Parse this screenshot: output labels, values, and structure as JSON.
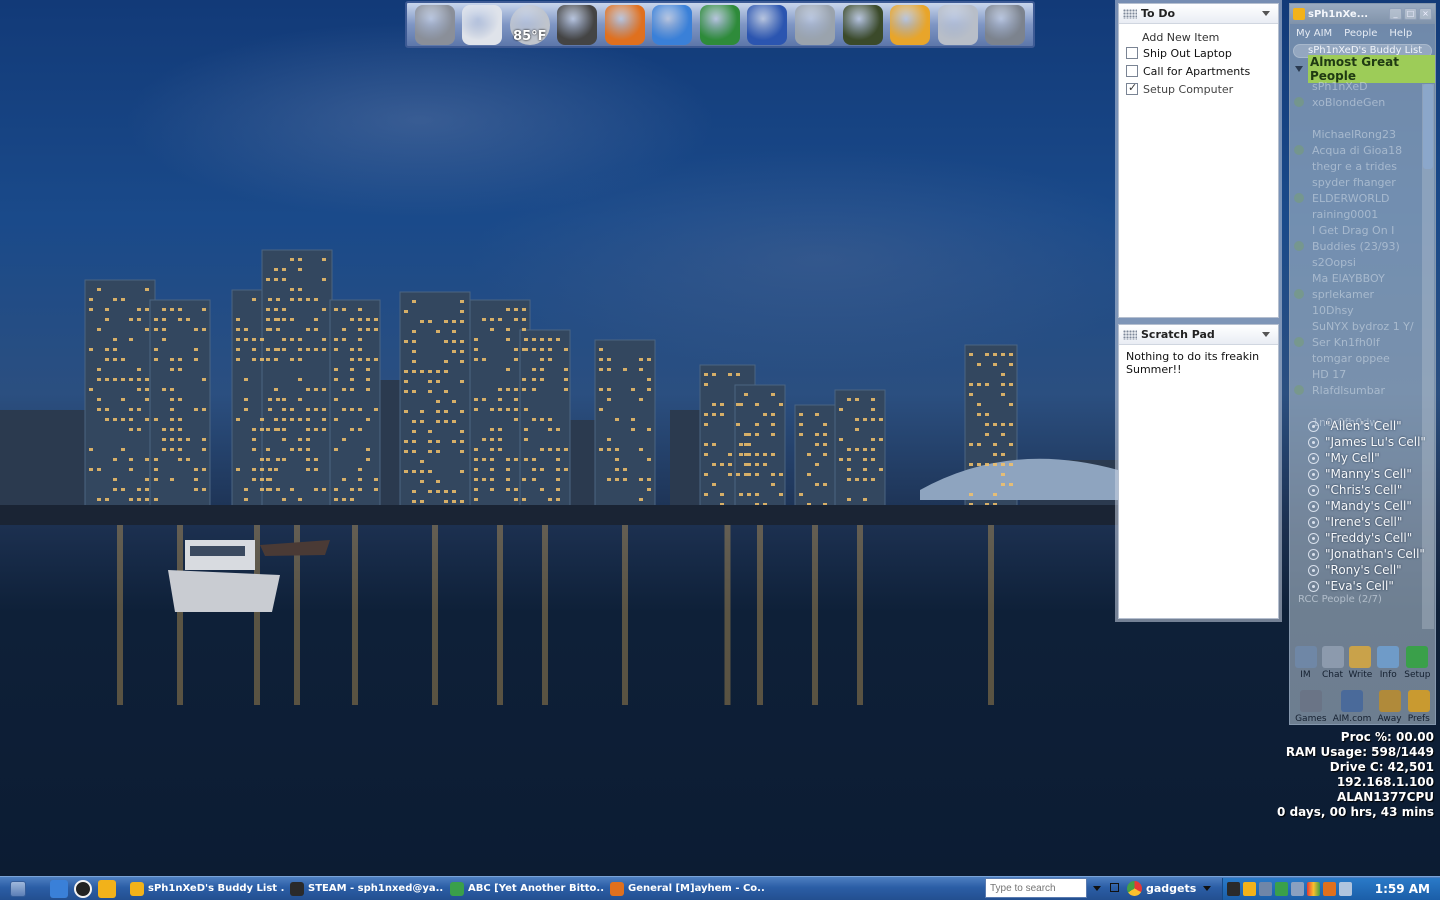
{
  "dock": {
    "weather_temp": "85°F",
    "icons": [
      {
        "name": "hard-drive-icon",
        "color": "#8a8f99"
      },
      {
        "name": "recycle-bin-icon",
        "color": "#dfe3ea"
      },
      {
        "name": "weather-moon-icon",
        "color": "#bfc4cc"
      },
      {
        "name": "counter-strike-icon",
        "color": "#444444"
      },
      {
        "name": "firefox-browser-icon",
        "color": "#e0701e"
      },
      {
        "name": "internet-explorer-6-icon",
        "color": "#3a80d8"
      },
      {
        "name": "excel-icon",
        "color": "#2e8b3a"
      },
      {
        "name": "word-icon",
        "color": "#2b55b0"
      },
      {
        "name": "napster-icon",
        "color": "#9aa3ad"
      },
      {
        "name": "network-globe-icon",
        "color": "#3b4a2a"
      },
      {
        "name": "winamp-icon",
        "color": "#e8a52a"
      },
      {
        "name": "tools-icon",
        "color": "#b8bec8"
      },
      {
        "name": "camera-icon",
        "color": "#7c838e"
      }
    ]
  },
  "todo": {
    "title": "To Do",
    "add_label": "Add New Item",
    "items": [
      {
        "label": "Ship Out Laptop",
        "checked": false
      },
      {
        "label": "Call for Apartments",
        "checked": false
      },
      {
        "label": "Setup Computer",
        "checked": true
      }
    ]
  },
  "scratch": {
    "title": "Scratch Pad",
    "text": "Nothing to do its freakin Summer!!"
  },
  "buddy": {
    "title": "sPh1nXe...",
    "menu": [
      "My AIM",
      "People",
      "Help"
    ],
    "search_text": "sPh1nXeD's Buddy List",
    "group_name": "Almost Great People",
    "faded_rows": [
      "sPh1nXeD",
      "xoBlondeGen",
      "",
      "MichaelRong23",
      "Acqua di Gioa18",
      "thegr e a trides",
      "spyder fhanger",
      "ELDERWORLD",
      "raining0001",
      "I Get Drag On I",
      "Buddies (23/93)",
      "s2Oopsi",
      "Ma ElAYBBOY",
      "sprlekamer",
      "10Dhsy",
      "SuNYX bydroz 1 Y/",
      "Ser Kn1fh0lf",
      "tomgar oppee",
      "HD 17",
      "Rlafdlsumbar",
      "",
      "1n0r0fh0dw"
    ],
    "cell_rows": [
      "\"Allen's Cell\"",
      "\"James Lu's Cell\"",
      "\"My Cell\"",
      "\"Manny's Cell\"",
      "\"Chris's Cell\"",
      "\"Mandy's Cell\"",
      "\"Irene's Cell\"",
      "\"Freddy's Cell\"",
      "\"Jonathan's Cell\"",
      "\"Rony's Cell\"",
      "\"Eva's  Cell\""
    ],
    "group_foot": "RCC People (2/7)",
    "toolbar1": [
      "IM",
      "Chat",
      "Write",
      "Info",
      "Setup"
    ],
    "toolbar2": [
      "Games",
      "AIM.com",
      "Away",
      "Prefs"
    ]
  },
  "stats": {
    "proc": "Proc %: 00.00",
    "ram": "RAM Usage: 598/1449",
    "drive": "Drive C: 42,501",
    "ip": "192.168.1.100",
    "host": "ALAN1377CPU",
    "uptime": "0 days, 00 hrs, 43 mins"
  },
  "taskbar": {
    "tasks": [
      {
        "label": "sPh1nXeD's Buddy List ...",
        "icon": "aim-running-man-icon",
        "color": "#f2b21a"
      },
      {
        "label": "STEAM - sph1nxed@ya...",
        "icon": "steam-icon",
        "color": "#2a2a2a"
      },
      {
        "label": "ABC [Yet Another Bitto...",
        "icon": "bittorrent-icon",
        "color": "#3aa04a"
      },
      {
        "label": "General [M]ayhem - Co...",
        "icon": "firefox-icon",
        "color": "#e0701e"
      }
    ],
    "search_placeholder": "Type to search",
    "gadgets_label": "gadgets",
    "clock": "1:59 AM"
  },
  "colors": {
    "sky_top": "#123a78",
    "water": "#0c1c33",
    "taskbar": "#2b5ea6",
    "group_highlight": "#9dcc58"
  }
}
